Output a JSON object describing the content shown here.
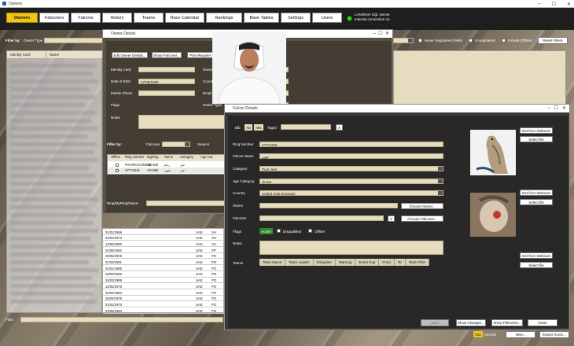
{
  "window": {
    "title": "Owners"
  },
  "nav": [
    {
      "label": "Owners",
      "active": true
    },
    {
      "label": "Falconers"
    },
    {
      "label": "Falcons"
    },
    {
      "label": "History"
    },
    {
      "label": "Teams"
    },
    {
      "label": "Race Calendar"
    },
    {
      "label": "Rankings"
    },
    {
      "label": "Base Tables"
    },
    {
      "label": "Settings"
    },
    {
      "label": "Users"
    }
  ],
  "status": {
    "line1": "LAN/WAN SQL Server",
    "line2": "Internet connection on"
  },
  "filter": {
    "label": "Filter by:",
    "owner_type_label": "Owner Type",
    "never_registered": "Never Registered (Web)",
    "unregistered": "Unregistered",
    "include_offlines": "Include Offlines",
    "reset": "Reset Filters"
  },
  "main_table": {
    "columns": [
      "Identity Card",
      "Name"
    ]
  },
  "bg_table": {
    "rows": [
      {
        "date": "01/01/1969",
        "c1": "UAE",
        "c2": "SH"
      },
      {
        "date": "01/01/1973",
        "c1": "UAE",
        "c2": "SH"
      },
      {
        "date": "13/08/1980",
        "c1": "UAE",
        "c2": "SH"
      },
      {
        "date": "01/06/1982",
        "c1": "UAE",
        "c2": "PP"
      },
      {
        "date": "26/03/2009",
        "c1": "UAE",
        "c2": "PO"
      },
      {
        "date": "01/03/1991",
        "c1": "UAE",
        "c2": "PO"
      },
      {
        "date": "01/01/1985",
        "c1": "UAE",
        "c2": "PO"
      },
      {
        "date": "26/03/1986",
        "c1": "UAE",
        "c2": "PO"
      },
      {
        "date": "26/03/1988",
        "c1": "UAE",
        "c2": "PO"
      },
      {
        "date": "12/02/1979",
        "c1": "UAE",
        "c2": "PO"
      },
      {
        "date": "20/04/1984",
        "c1": "UAE",
        "c2": "PO"
      },
      {
        "date": "26/03/1978",
        "c1": "UAE",
        "c2": "PO"
      },
      {
        "date": "01/01/1973",
        "c1": "UAE",
        "c2": "PO"
      },
      {
        "date": "04/06/1983",
        "c1": "UAE",
        "c2": "PO"
      },
      {
        "date": "26/03/1996",
        "c1": "UAE",
        "c2": "PO"
      },
      {
        "date": "25/01/1991",
        "c1": "UAE",
        "c2": "PO"
      }
    ]
  },
  "owner": {
    "title": "Owner Details",
    "btn_edit": "Edit Owner Details...",
    "btn_show_falconer": "Show Falconer...",
    "btn_print": "Print Register Card...",
    "identity_card": "Identity Card",
    "name": "Name",
    "dob_label": "Date of Birth",
    "dob": "27/08/1980",
    "country_label": "Country",
    "country": "United Arab Emirates",
    "mobile": "Mobile Phone",
    "email": "Email Address",
    "flags": "Flags",
    "owner_type": "Owner Type",
    "notes": "Notes",
    "filter_by": "Filter by:",
    "falconer": "Falconer",
    "season": "Season",
    "grid_columns": [
      "Offline",
      "Ring Number",
      "MgRing",
      "Name",
      "Category",
      "Age Cat"
    ],
    "grid_rows": [
      {
        "ring": "#HASRACONE01",
        "mg": "AD-833",
        "name": "رجيا",
        "cat": "جير"
      },
      {
        "ring": "477ANUK",
        "mg": "AD-895",
        "name": "جوير",
        "cat": "جير"
      }
    ],
    "ring_search": "Ring/MgRing/Name:"
  },
  "falcon": {
    "title": "Falcon Details",
    "bib_label": "Bib",
    "bib1": "AD",
    "bib2": "895",
    "tag_label": "TagID",
    "ring_label": "Ring Number",
    "ring": "477ANUK",
    "name_label": "Falcon Name",
    "name": "جوير",
    "category_label": "Category",
    "category": "Pure Jeer",
    "age_label": "Age Category",
    "age": "Jirnas",
    "country_label": "Country",
    "country": "United Arab Emirates",
    "owner_label": "Owner",
    "choose_owner": "Choose Owner...",
    "falconer_label": "Falconer",
    "choose_falconer": "Choose Falconer...",
    "x": "X",
    "flags_label": "Flags",
    "active": "Active",
    "disqualified": "Disqualified",
    "offline": "Offline",
    "notes_label": "Notes",
    "teams_label": "Teams",
    "team_tabs": [
      "Team Name",
      "Team Leader",
      "Discipline",
      "Warning",
      "Event Cup",
      "From",
      "To",
      "Team Pilot"
    ],
    "webcam": "Get from Webcam",
    "select_file": "Select file",
    "save": "Save",
    "show_changes": "Show Changes...",
    "show_palmares": "Show Palmares...",
    "close": "Close"
  },
  "footer": {
    "filter_label": "Filter:",
    "records_count": "511",
    "records_label": "records",
    "new": "New...",
    "export": "Export XLSX..."
  },
  "colors": {
    "accent": "#f0c419",
    "field": "#e6dcbf",
    "status_green": "#35d12e"
  }
}
